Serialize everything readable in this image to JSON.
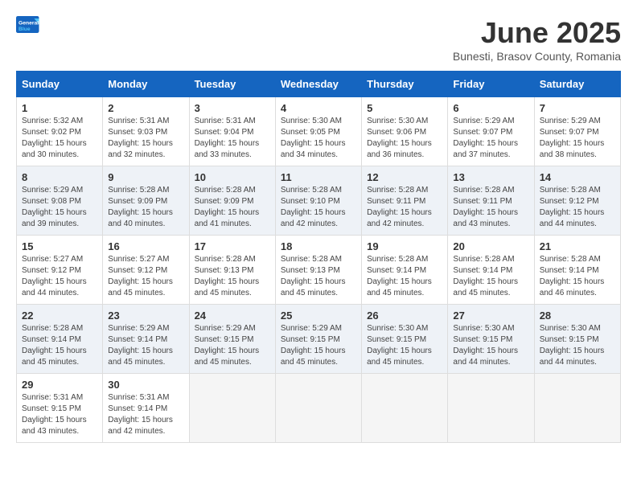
{
  "header": {
    "logo_general": "General",
    "logo_blue": "Blue",
    "title": "June 2025",
    "subtitle": "Bunesti, Brasov County, Romania"
  },
  "calendar": {
    "days_of_week": [
      "Sunday",
      "Monday",
      "Tuesday",
      "Wednesday",
      "Thursday",
      "Friday",
      "Saturday"
    ],
    "weeks": [
      [
        {
          "day": "",
          "content": ""
        },
        {
          "day": "2",
          "content": "Sunrise: 5:31 AM\nSunset: 9:03 PM\nDaylight: 15 hours\nand 32 minutes."
        },
        {
          "day": "3",
          "content": "Sunrise: 5:31 AM\nSunset: 9:04 PM\nDaylight: 15 hours\nand 33 minutes."
        },
        {
          "day": "4",
          "content": "Sunrise: 5:30 AM\nSunset: 9:05 PM\nDaylight: 15 hours\nand 34 minutes."
        },
        {
          "day": "5",
          "content": "Sunrise: 5:30 AM\nSunset: 9:06 PM\nDaylight: 15 hours\nand 36 minutes."
        },
        {
          "day": "6",
          "content": "Sunrise: 5:29 AM\nSunset: 9:07 PM\nDaylight: 15 hours\nand 37 minutes."
        },
        {
          "day": "7",
          "content": "Sunrise: 5:29 AM\nSunset: 9:07 PM\nDaylight: 15 hours\nand 38 minutes."
        }
      ],
      [
        {
          "day": "1",
          "content": "Sunrise: 5:32 AM\nSunset: 9:02 PM\nDaylight: 15 hours\nand 30 minutes."
        },
        {
          "day": "9",
          "content": "Sunrise: 5:28 AM\nSunset: 9:09 PM\nDaylight: 15 hours\nand 40 minutes."
        },
        {
          "day": "10",
          "content": "Sunrise: 5:28 AM\nSunset: 9:09 PM\nDaylight: 15 hours\nand 41 minutes."
        },
        {
          "day": "11",
          "content": "Sunrise: 5:28 AM\nSunset: 9:10 PM\nDaylight: 15 hours\nand 42 minutes."
        },
        {
          "day": "12",
          "content": "Sunrise: 5:28 AM\nSunset: 9:11 PM\nDaylight: 15 hours\nand 42 minutes."
        },
        {
          "day": "13",
          "content": "Sunrise: 5:28 AM\nSunset: 9:11 PM\nDaylight: 15 hours\nand 43 minutes."
        },
        {
          "day": "14",
          "content": "Sunrise: 5:28 AM\nSunset: 9:12 PM\nDaylight: 15 hours\nand 44 minutes."
        }
      ],
      [
        {
          "day": "8",
          "content": "Sunrise: 5:29 AM\nSunset: 9:08 PM\nDaylight: 15 hours\nand 39 minutes."
        },
        {
          "day": "16",
          "content": "Sunrise: 5:27 AM\nSunset: 9:12 PM\nDaylight: 15 hours\nand 45 minutes."
        },
        {
          "day": "17",
          "content": "Sunrise: 5:28 AM\nSunset: 9:13 PM\nDaylight: 15 hours\nand 45 minutes."
        },
        {
          "day": "18",
          "content": "Sunrise: 5:28 AM\nSunset: 9:13 PM\nDaylight: 15 hours\nand 45 minutes."
        },
        {
          "day": "19",
          "content": "Sunrise: 5:28 AM\nSunset: 9:14 PM\nDaylight: 15 hours\nand 45 minutes."
        },
        {
          "day": "20",
          "content": "Sunrise: 5:28 AM\nSunset: 9:14 PM\nDaylight: 15 hours\nand 45 minutes."
        },
        {
          "day": "21",
          "content": "Sunrise: 5:28 AM\nSunset: 9:14 PM\nDaylight: 15 hours\nand 46 minutes."
        }
      ],
      [
        {
          "day": "15",
          "content": "Sunrise: 5:27 AM\nSunset: 9:12 PM\nDaylight: 15 hours\nand 44 minutes."
        },
        {
          "day": "23",
          "content": "Sunrise: 5:29 AM\nSunset: 9:14 PM\nDaylight: 15 hours\nand 45 minutes."
        },
        {
          "day": "24",
          "content": "Sunrise: 5:29 AM\nSunset: 9:15 PM\nDaylight: 15 hours\nand 45 minutes."
        },
        {
          "day": "25",
          "content": "Sunrise: 5:29 AM\nSunset: 9:15 PM\nDaylight: 15 hours\nand 45 minutes."
        },
        {
          "day": "26",
          "content": "Sunrise: 5:30 AM\nSunset: 9:15 PM\nDaylight: 15 hours\nand 45 minutes."
        },
        {
          "day": "27",
          "content": "Sunrise: 5:30 AM\nSunset: 9:15 PM\nDaylight: 15 hours\nand 44 minutes."
        },
        {
          "day": "28",
          "content": "Sunrise: 5:30 AM\nSunset: 9:15 PM\nDaylight: 15 hours\nand 44 minutes."
        }
      ],
      [
        {
          "day": "22",
          "content": "Sunrise: 5:28 AM\nSunset: 9:14 PM\nDaylight: 15 hours\nand 45 minutes."
        },
        {
          "day": "30",
          "content": "Sunrise: 5:31 AM\nSunset: 9:14 PM\nDaylight: 15 hours\nand 42 minutes."
        },
        {
          "day": "",
          "content": ""
        },
        {
          "day": "",
          "content": ""
        },
        {
          "day": "",
          "content": ""
        },
        {
          "day": "",
          "content": ""
        },
        {
          "day": "",
          "content": ""
        }
      ],
      [
        {
          "day": "29",
          "content": "Sunrise: 5:31 AM\nSunset: 9:15 PM\nDaylight: 15 hours\nand 43 minutes."
        },
        {
          "day": "",
          "content": ""
        },
        {
          "day": "",
          "content": ""
        },
        {
          "day": "",
          "content": ""
        },
        {
          "day": "",
          "content": ""
        },
        {
          "day": "",
          "content": ""
        },
        {
          "day": "",
          "content": ""
        }
      ]
    ]
  }
}
